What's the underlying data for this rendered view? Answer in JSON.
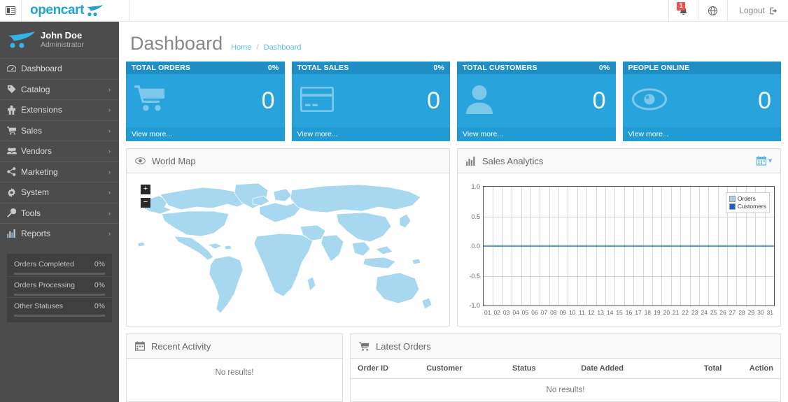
{
  "header": {
    "menu_toggle_icon": "sidebar-toggle-icon",
    "brand": "opencart",
    "brand_icon": "cart-logo-icon",
    "notification_icon": "bell-icon",
    "notification_count": "1",
    "language_icon": "globe-icon",
    "logout_label": "Logout",
    "logout_icon": "logout-icon"
  },
  "sidebar": {
    "profile": {
      "logo_icon": "cart-logo-icon",
      "name": "John Doe",
      "role": "Administrator"
    },
    "items": [
      {
        "label": "Dashboard",
        "icon": "dashboard-icon",
        "caret": ""
      },
      {
        "label": "Catalog",
        "icon": "tag-icon",
        "caret": "›"
      },
      {
        "label": "Extensions",
        "icon": "puzzle-icon",
        "caret": "›"
      },
      {
        "label": "Sales",
        "icon": "cart-icon",
        "caret": "›"
      },
      {
        "label": "Vendors",
        "icon": "users-icon",
        "caret": "›"
      },
      {
        "label": "Marketing",
        "icon": "share-icon",
        "caret": "›"
      },
      {
        "label": "System",
        "icon": "gear-icon",
        "caret": "›"
      },
      {
        "label": "Tools",
        "icon": "wrench-icon",
        "caret": "›"
      },
      {
        "label": "Reports",
        "icon": "bar-chart-icon",
        "caret": "›"
      }
    ],
    "progress": [
      {
        "label": "Orders Completed",
        "value": "0%",
        "percent": 0
      },
      {
        "label": "Orders Processing",
        "value": "0%",
        "percent": 0
      },
      {
        "label": "Other Statuses",
        "value": "0%",
        "percent": 0
      }
    ]
  },
  "page": {
    "title": "Dashboard",
    "breadcrumb": {
      "home": "Home",
      "separator": "/",
      "current": "Dashboard"
    }
  },
  "tiles": [
    {
      "title": "TOTAL ORDERS",
      "percent": "0%",
      "value": "0",
      "icon": "shopping-cart-icon",
      "footer": "View more...",
      "head_color": "#1f8ec4",
      "body_color": "#29a3dc",
      "foot_color": "#229bd4"
    },
    {
      "title": "TOTAL SALES",
      "percent": "0%",
      "value": "0",
      "icon": "credit-card-icon",
      "footer": "View more...",
      "head_color": "#1f8ec4",
      "body_color": "#29a3dc",
      "foot_color": "#229bd4"
    },
    {
      "title": "TOTAL CUSTOMERS",
      "percent": "0%",
      "value": "0",
      "icon": "user-icon",
      "footer": "View more...",
      "head_color": "#1f8ec4",
      "body_color": "#29a3dc",
      "foot_color": "#229bd4"
    },
    {
      "title": "PEOPLE ONLINE",
      "percent": "",
      "value": "0",
      "icon": "eye-icon",
      "footer": "View more...",
      "head_color": "#1f8ec4",
      "body_color": "#29a3dc",
      "foot_color": "#229bd4"
    }
  ],
  "world_map": {
    "title": "World Map",
    "icon": "eye-icon",
    "zoom_in": "+",
    "zoom_out": "−",
    "map_color": "#a8d8f0",
    "border_color": "#ffffff"
  },
  "sales_analytics": {
    "title": "Sales Analytics",
    "icon": "bar-chart-icon",
    "range_icon": "calendar-icon",
    "range_caret": "▾"
  },
  "chart_data": {
    "type": "line",
    "title": "Sales Analytics",
    "x": [
      "01",
      "02",
      "03",
      "04",
      "05",
      "06",
      "07",
      "08",
      "09",
      "10",
      "11",
      "12",
      "13",
      "14",
      "15",
      "16",
      "17",
      "18",
      "19",
      "20",
      "21",
      "22",
      "23",
      "24",
      "25",
      "26",
      "27",
      "28",
      "29",
      "30",
      "31"
    ],
    "xlabel": "",
    "ylabel": "",
    "ylim": [
      -1.0,
      1.0
    ],
    "yticks": [
      "1.0",
      "0.5",
      "0.0",
      "-0.5",
      "-1.0"
    ],
    "grid": true,
    "legend_position": "top-right",
    "series": [
      {
        "name": "Orders",
        "color": "#a5cfe8",
        "values": [
          0,
          0,
          0,
          0,
          0,
          0,
          0,
          0,
          0,
          0,
          0,
          0,
          0,
          0,
          0,
          0,
          0,
          0,
          0,
          0,
          0,
          0,
          0,
          0,
          0,
          0,
          0,
          0,
          0,
          0,
          0
        ]
      },
      {
        "name": "Customers",
        "color": "#1a61c4",
        "values": [
          0,
          0,
          0,
          0,
          0,
          0,
          0,
          0,
          0,
          0,
          0,
          0,
          0,
          0,
          0,
          0,
          0,
          0,
          0,
          0,
          0,
          0,
          0,
          0,
          0,
          0,
          0,
          0,
          0,
          0,
          0
        ]
      }
    ],
    "line_color": "#5b9bd5"
  },
  "recent_activity": {
    "title": "Recent Activity",
    "icon": "calendar-icon",
    "empty": "No results!"
  },
  "latest_orders": {
    "title": "Latest Orders",
    "icon": "cart-icon",
    "columns": [
      "Order ID",
      "Customer",
      "Status",
      "Date Added",
      "Total",
      "Action"
    ],
    "rows": [],
    "empty": "No results!"
  }
}
